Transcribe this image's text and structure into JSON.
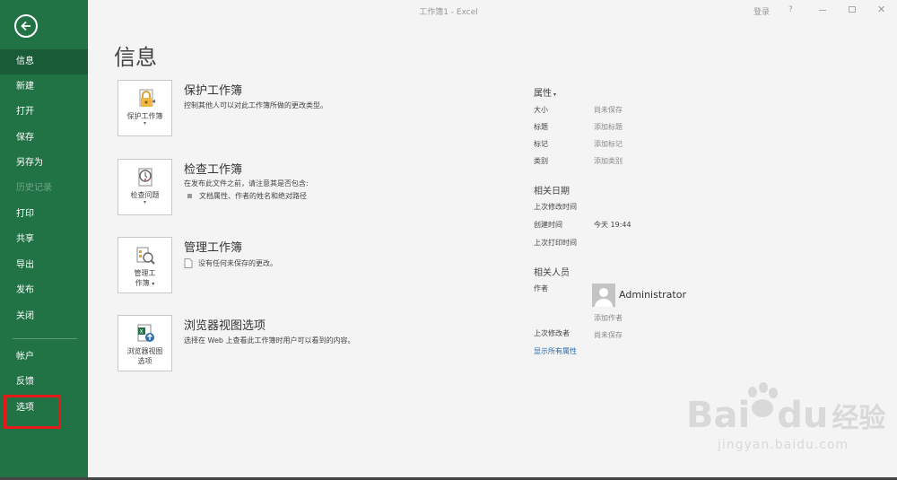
{
  "window": {
    "title": "工作簿1 - Excel",
    "login": "登录",
    "help": "?",
    "close": "✕"
  },
  "sidebar": {
    "items": [
      {
        "label": "信息",
        "state": "active"
      },
      {
        "label": "新建"
      },
      {
        "label": "打开"
      },
      {
        "label": "保存"
      },
      {
        "label": "另存为"
      },
      {
        "label": "历史记录",
        "state": "disabled"
      },
      {
        "label": "打印"
      },
      {
        "label": "共享"
      },
      {
        "label": "导出"
      },
      {
        "label": "发布"
      },
      {
        "label": "关闭"
      }
    ],
    "lower_items": [
      {
        "label": "帐户"
      },
      {
        "label": "反馈"
      },
      {
        "label": "选项",
        "highlighted": true
      }
    ],
    "accent": "#217346",
    "highlight_color": "#e81919"
  },
  "main": {
    "title": "信息",
    "sections": [
      {
        "button_label": "保护工作簿",
        "title": "保护工作簿",
        "description": "控制其他人可以对此工作簿所做的更改类型。",
        "icon": "lock-icon"
      },
      {
        "button_label": "检查问题",
        "title": "检查工作簿",
        "description": "在发布此文件之前，请注意其是否包含:",
        "bullet": "文档属性、作者的姓名和绝对路径",
        "icon": "inspect-icon"
      },
      {
        "button_label_1": "管理工",
        "button_label_2": "作簿",
        "title": "管理工作簿",
        "description": "没有任何未保存的更改。",
        "icon": "manage-workbook-icon"
      },
      {
        "button_label_1": "浏览器视图",
        "button_label_2": "选项",
        "title": "浏览器视图选项",
        "description": "选择在 Web 上查看此工作簿时用户可以看到的内容。",
        "icon": "browser-view-icon"
      }
    ]
  },
  "properties": {
    "heading": "属性",
    "size_key": "大小",
    "size_val": "尚未保存",
    "title_key": "标题",
    "title_val": "添加标题",
    "tags_key": "标记",
    "tags_val": "添加标记",
    "category_key": "类别",
    "category_val": "添加类别",
    "dates_heading": "相关日期",
    "modified_key": "上次修改时间",
    "created_key": "创建时间",
    "created_val": "今天 19:44",
    "printed_key": "上次打印时间",
    "people_heading": "相关人员",
    "author_key": "作者",
    "author_name": "Administrator",
    "add_author": "添加作者",
    "last_modified_by_key": "上次修改者",
    "last_modified_by_val": "尚未保存",
    "show_all": "显示所有属性"
  },
  "watermark": {
    "brand_left": "Bai",
    "brand_right": "du",
    "brand_cn": "经验",
    "url": "jingyan.baidu.com"
  }
}
